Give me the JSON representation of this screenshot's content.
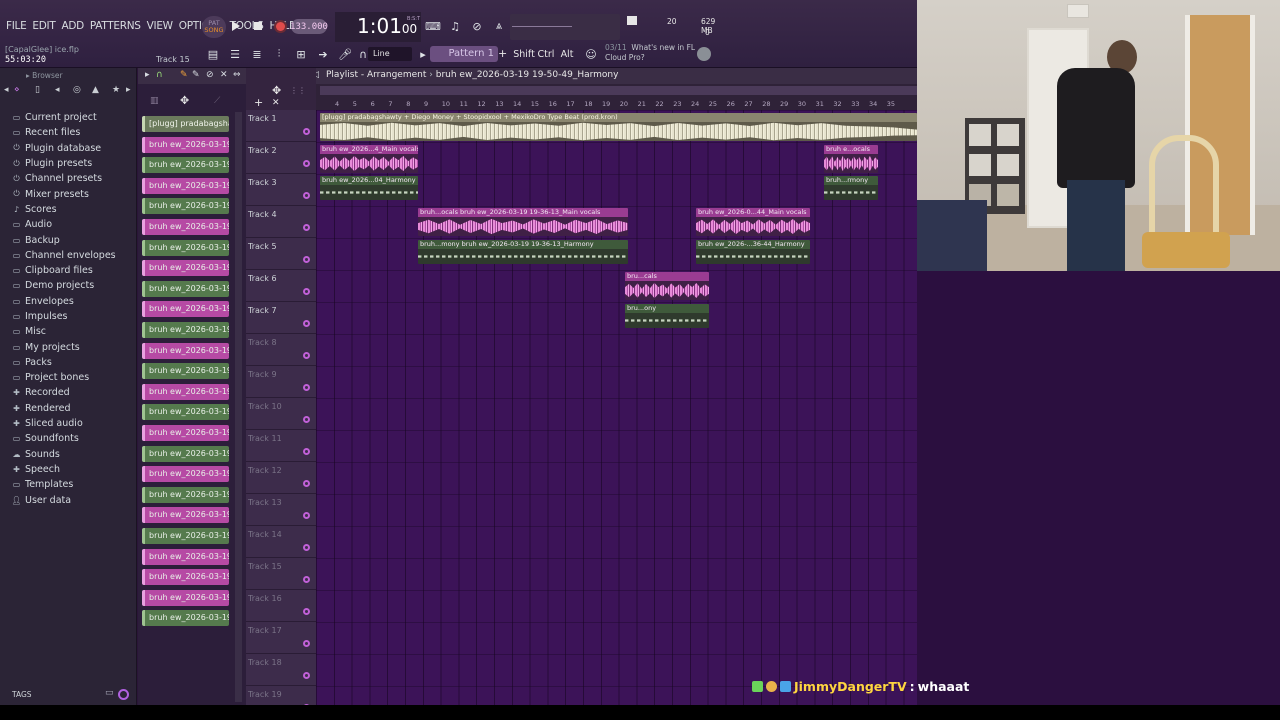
{
  "menu": [
    "FILE",
    "EDIT",
    "ADD",
    "PATTERNS",
    "VIEW",
    "OPTIONS",
    "TOOLS",
    "HELP"
  ],
  "project": {
    "file": "[CapalGlee] ice.flp",
    "clock": "55:03:20",
    "track_hint": "Track 15"
  },
  "transport": {
    "mode_top": "PAT",
    "mode_bottom": "SONG",
    "tempo": "133.000",
    "time": "1:01",
    "time_small": "00",
    "time_label": "B:S:T"
  },
  "perf": {
    "cpu": "20",
    "mem": "629 MB",
    "poly": "0"
  },
  "toolbar": {
    "snap": "Line",
    "pattern": "Pattern 1",
    "pattern_add": "+",
    "shift": "Shift",
    "ctrl": "Ctrl",
    "alt": "Alt"
  },
  "news": {
    "date": "03/11",
    "line1": "What's new in FL",
    "line2": "Cloud Pro?"
  },
  "browser": {
    "title": "Browser",
    "items": [
      {
        "label": "Current project",
        "icon": "folder-icon"
      },
      {
        "label": "Recent files",
        "icon": "folder-icon"
      },
      {
        "label": "Plugin database",
        "icon": "plug-icon"
      },
      {
        "label": "Plugin presets",
        "icon": "plug-icon"
      },
      {
        "label": "Channel presets",
        "icon": "plug-icon"
      },
      {
        "label": "Mixer presets",
        "icon": "plug-icon"
      },
      {
        "label": "Scores",
        "icon": "note-icon"
      },
      {
        "label": "Audio",
        "icon": "folder-icon"
      },
      {
        "label": "Backup",
        "icon": "folder-icon"
      },
      {
        "label": "Channel envelopes",
        "icon": "folder-icon"
      },
      {
        "label": "Clipboard files",
        "icon": "folder-icon"
      },
      {
        "label": "Demo projects",
        "icon": "folder-icon"
      },
      {
        "label": "Envelopes",
        "icon": "folder-icon"
      },
      {
        "label": "Impulses",
        "icon": "folder-icon"
      },
      {
        "label": "Misc",
        "icon": "folder-icon"
      },
      {
        "label": "My projects",
        "icon": "folder-icon"
      },
      {
        "label": "Packs",
        "icon": "folder-icon"
      },
      {
        "label": "Project bones",
        "icon": "folder-icon"
      },
      {
        "label": "Recorded",
        "icon": "plus-icon"
      },
      {
        "label": "Rendered",
        "icon": "plus-icon"
      },
      {
        "label": "Sliced audio",
        "icon": "plus-icon"
      },
      {
        "label": "Soundfonts",
        "icon": "folder-icon"
      },
      {
        "label": "Sounds",
        "icon": "cloud-icon"
      },
      {
        "label": "Speech",
        "icon": "plus-icon"
      },
      {
        "label": "Templates",
        "icon": "folder-icon"
      },
      {
        "label": "User data",
        "icon": "user-icon"
      }
    ],
    "tags": "TAGS"
  },
  "picker": [
    {
      "label": "[plugg] pradabagsha...",
      "color": "first"
    },
    {
      "label": "bruh ew_2026-03-19 19...",
      "color": "pink"
    },
    {
      "label": "bruh ew_2026-03-19 19...",
      "color": "green"
    },
    {
      "label": "bruh ew_2026-03-19 19...",
      "color": "pink"
    },
    {
      "label": "bruh ew_2026-03-19 19...",
      "color": "green"
    },
    {
      "label": "bruh ew_2026-03-19 19...",
      "color": "pink"
    },
    {
      "label": "bruh ew_2026-03-19 19...",
      "color": "green"
    },
    {
      "label": "bruh ew_2026-03-19 19...",
      "color": "pink"
    },
    {
      "label": "bruh ew_2026-03-19 19...",
      "color": "green"
    },
    {
      "label": "bruh ew_2026-03-19 19...",
      "color": "pink"
    },
    {
      "label": "bruh ew_2026-03-19 19...",
      "color": "green"
    },
    {
      "label": "bruh ew_2026-03-19 19...",
      "color": "pink"
    },
    {
      "label": "bruh ew_2026-03-19 19...",
      "color": "green"
    },
    {
      "label": "bruh ew_2026-03-19 19...",
      "color": "pink"
    },
    {
      "label": "bruh ew_2026-03-19 19...",
      "color": "green"
    },
    {
      "label": "bruh ew_2026-03-19 19...",
      "color": "pink"
    },
    {
      "label": "bruh ew_2026-03-19 19...",
      "color": "green"
    },
    {
      "label": "bruh ew_2026-03-19 19...",
      "color": "pink"
    },
    {
      "label": "bruh ew_2026-03-19 19...",
      "color": "green"
    },
    {
      "label": "bruh ew_2026-03-19 19...",
      "color": "pink"
    },
    {
      "label": "bruh ew_2026-03-19 19...",
      "color": "green"
    },
    {
      "label": "bruh ew_2026-03-19 19...",
      "color": "pink"
    },
    {
      "label": "bruh ew_2026-03-19 19...",
      "color": "pink"
    },
    {
      "label": "bruh ew_2026-03-19 19...",
      "color": "pink"
    },
    {
      "label": "bruh ew_2026-03-19 19...",
      "color": "green"
    }
  ],
  "playlist": {
    "title": "Playlist - Arrangement",
    "separator": "›",
    "pattern": "bruh ew_2026-03-19 19-50-49_Harmony",
    "ruler": [
      "4",
      "5",
      "6",
      "7",
      "8",
      "9",
      "10",
      "11",
      "12",
      "13",
      "14",
      "15",
      "16",
      "17",
      "18",
      "19",
      "20",
      "21",
      "22",
      "23",
      "24",
      "25",
      "26",
      "27",
      "28",
      "29",
      "30",
      "31",
      "32",
      "33",
      "34",
      "35"
    ],
    "tracks": [
      "Track 1",
      "Track 2",
      "Track 3",
      "Track 4",
      "Track 5",
      "Track 6",
      "Track 7",
      "Track 8",
      "Track 9",
      "Track 10",
      "Track 11",
      "Track 12",
      "Track 13",
      "Track 14",
      "Track 15",
      "Track 16",
      "Track 17",
      "Track 18",
      "Track 19"
    ],
    "clips": [
      {
        "label": "[plugg] pradabagshawty + Diego Money + Stoopidxool + MexikoDro Type Beat (prod.kron)",
        "kind": "beige"
      },
      {
        "label": "bruh ew_2026...4_Main vocals",
        "kind": "pink"
      },
      {
        "label": "bruh ew_2026...04_Harmony",
        "kind": "green"
      },
      {
        "label": "bruh e...ocals",
        "kind": "pink"
      },
      {
        "label": "bruh...rmony",
        "kind": "green"
      },
      {
        "label": "bruh...ocals  bruh ew_2026-03-19 19-36-13_Main vocals",
        "kind": "pink"
      },
      {
        "label": "bruh...mony  bruh ew_2026-03-19 19-36-13_Harmony",
        "kind": "green"
      },
      {
        "label": "bruh ew_2026-0...44_Main vocals",
        "kind": "pink"
      },
      {
        "label": "bruh ew_2026-...36-44_Harmony",
        "kind": "green"
      },
      {
        "label": "bru...cals",
        "kind": "pink"
      },
      {
        "label": "bru...ony",
        "kind": "green"
      }
    ]
  },
  "chat": {
    "user": "JimmyDangerTV",
    "colon": ":",
    "message": "whaaat"
  },
  "colors": {
    "accent": "#b064e0",
    "pink_clip": "#e78bd8",
    "green_clip": "#6f8568",
    "chat_user": "#ffd640"
  }
}
